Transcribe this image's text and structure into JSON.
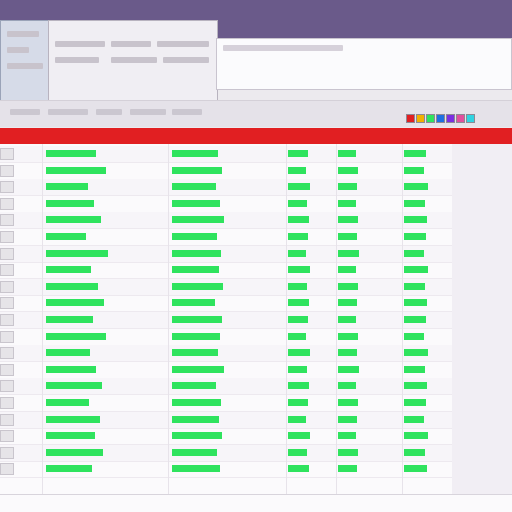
{
  "colors": {
    "desktop": "#6a5a8a",
    "header": "#e11f22",
    "cell_fill": "#2fe35e",
    "grid_bg": "#fbfafc"
  },
  "ribbon": {
    "title": "",
    "tabs": []
  },
  "grid": {
    "headers": [
      "",
      "",
      "",
      "",
      "",
      ""
    ],
    "columns": 6,
    "rows": 20
  }
}
